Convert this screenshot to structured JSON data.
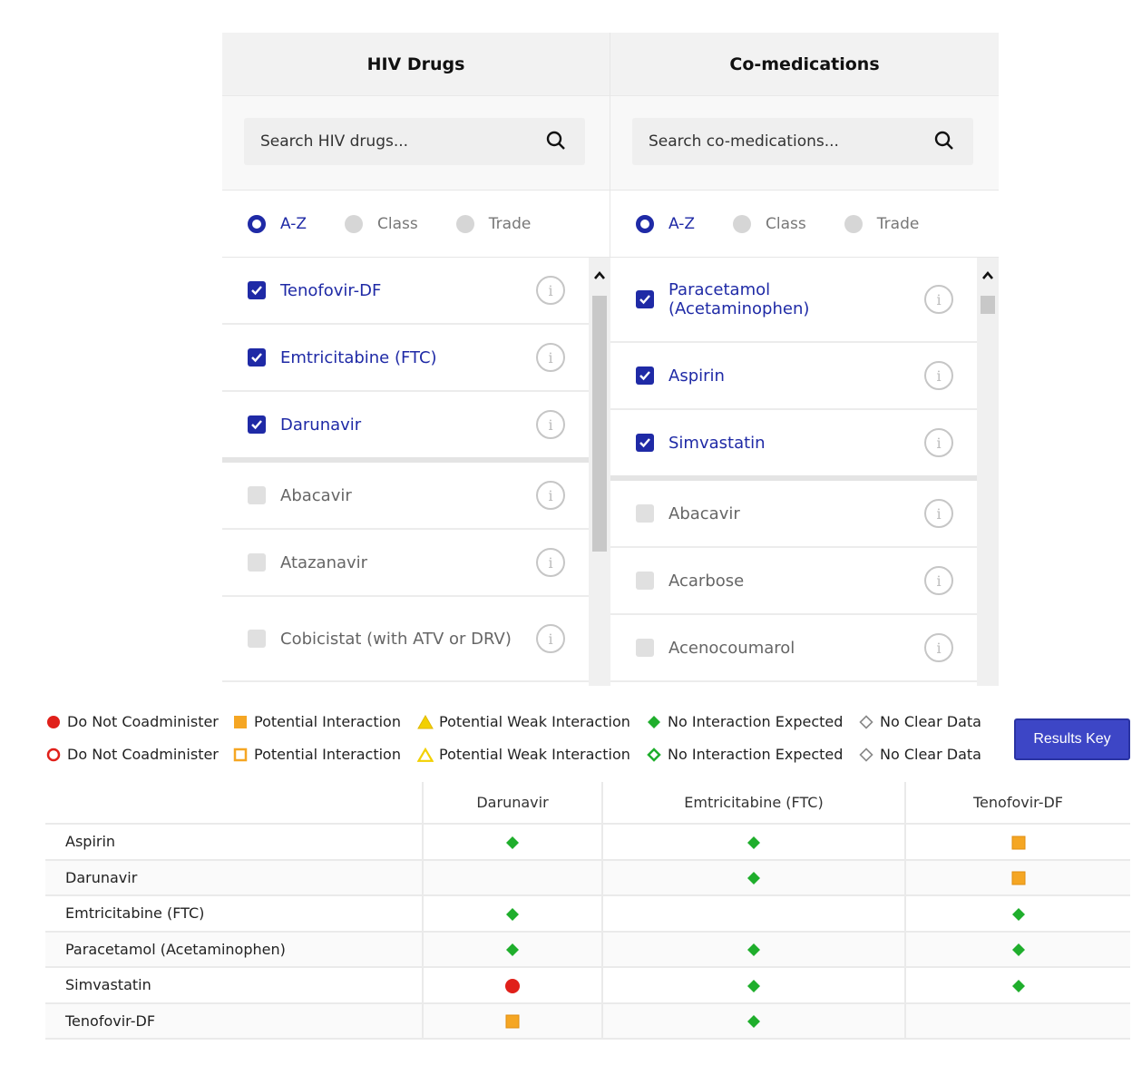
{
  "panels": [
    {
      "title": "HIV Drugs",
      "search_placeholder": "Search HIV drugs...",
      "sort_options": [
        {
          "label": "A-Z",
          "selected": true
        },
        {
          "label": "Class",
          "selected": false
        },
        {
          "label": "Trade",
          "selected": false
        }
      ],
      "items": [
        {
          "label": "Tenofovir-DF",
          "checked": true
        },
        {
          "label": "Emtricitabine (FTC)",
          "checked": true
        },
        {
          "label": "Darunavir",
          "checked": true
        },
        {
          "label": "Abacavir",
          "checked": false
        },
        {
          "label": "Atazanavir",
          "checked": false
        },
        {
          "label": "Cobicistat (with ATV or DRV)",
          "checked": false
        }
      ]
    },
    {
      "title": "Co-medications",
      "search_placeholder": "Search co-medications...",
      "sort_options": [
        {
          "label": "A-Z",
          "selected": true
        },
        {
          "label": "Class",
          "selected": false
        },
        {
          "label": "Trade",
          "selected": false
        }
      ],
      "items": [
        {
          "label": "Paracetamol (Acetaminophen)",
          "checked": true
        },
        {
          "label": "Aspirin",
          "checked": true
        },
        {
          "label": "Simvastatin",
          "checked": true
        },
        {
          "label": "Abacavir",
          "checked": false
        },
        {
          "label": "Acarbose",
          "checked": false
        },
        {
          "label": "Acenocoumarol",
          "checked": false
        }
      ]
    }
  ],
  "legend": {
    "row1": [
      {
        "label": "Do Not Coadminister",
        "icon": "red-circle-filled-icon"
      },
      {
        "label": "Potential Interaction",
        "icon": "orange-square-filled-icon"
      },
      {
        "label": "Potential Weak Interaction",
        "icon": "yellow-triangle-filled-icon"
      },
      {
        "label": "No Interaction Expected",
        "icon": "green-diamond-filled-icon"
      },
      {
        "label": "No Clear Data",
        "icon": "grey-diamond-outline-icon"
      }
    ],
    "row2": [
      {
        "label": "Do Not Coadminister",
        "icon": "red-circle-outline-icon"
      },
      {
        "label": "Potential Interaction",
        "icon": "orange-square-outline-icon"
      },
      {
        "label": "Potential Weak Interaction",
        "icon": "yellow-triangle-outline-icon"
      },
      {
        "label": "No Interaction Expected",
        "icon": "green-diamond-outline-icon"
      },
      {
        "label": "No Clear Data",
        "icon": "grey-diamond-outline-icon"
      }
    ]
  },
  "results_key_label": "Results Key",
  "results": {
    "columns": [
      "Darunavir",
      "Emtricitabine (FTC)",
      "Tenofovir-DF"
    ],
    "rows": [
      {
        "drug": "Aspirin",
        "cells": [
          "green",
          "green",
          "orange"
        ]
      },
      {
        "drug": "Darunavir",
        "cells": [
          "",
          "green",
          "orange"
        ]
      },
      {
        "drug": "Emtricitabine (FTC)",
        "cells": [
          "green",
          "",
          "green"
        ]
      },
      {
        "drug": "Paracetamol (Acetaminophen)",
        "cells": [
          "green",
          "green",
          "green"
        ]
      },
      {
        "drug": "Simvastatin",
        "cells": [
          "red",
          "green",
          "green"
        ]
      },
      {
        "drug": "Tenofovir-DF",
        "cells": [
          "orange",
          "green",
          ""
        ]
      }
    ]
  },
  "colors": {
    "accent": "#1f2aa6",
    "button": "#3d46c6",
    "red": "#e0201a",
    "orange": "#f5a623",
    "yellow": "#f2d000",
    "green": "#1fae2c",
    "grey": "#888888"
  }
}
